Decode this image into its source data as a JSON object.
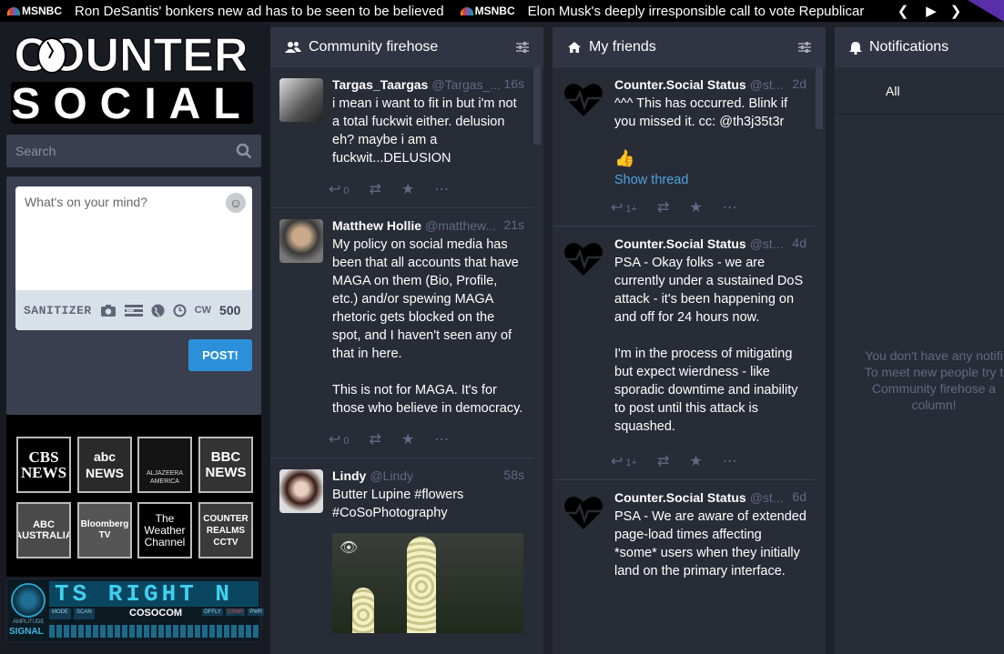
{
  "ticker": {
    "items": [
      {
        "source": "MSNBC",
        "headline": "Ron DeSantis' bonkers new ad has to be seen to be believed"
      },
      {
        "source": "MSNBC",
        "headline": "Elon Musk's deeply irresponsible call to vote Republicar"
      }
    ],
    "prev_icon": "chevron-left-icon",
    "play_icon": "play-icon",
    "next_icon": "chevron-right-icon"
  },
  "logo": {
    "line1": "COUNTER",
    "line2": "SOCIAL"
  },
  "search": {
    "placeholder": "Search"
  },
  "compose": {
    "placeholder": "What's on your mind?",
    "sanitizer_label": "SANITIZER",
    "cw_label": "CW",
    "char_count": "500",
    "post_label": "POST!"
  },
  "news_channels": [
    {
      "name": "CBS NEWS"
    },
    {
      "name": "abc NEWS"
    },
    {
      "name": "ALJAZEERA AMERICA"
    },
    {
      "name": "BBC NEWS"
    },
    {
      "name": "ABC AUSTRALIA"
    },
    {
      "name": "Bloomberg TV"
    },
    {
      "name": "The Weather Channel"
    },
    {
      "name": "COUNTER REALMS CCTV"
    }
  ],
  "radio": {
    "display": "TS RIGHT N",
    "brand": "COSOCOM",
    "signal_label": "SIGNAL",
    "amplitude_label": "AMPLITUDE",
    "buttons": [
      "MODE",
      "SCAN",
      "OFFLY",
      "OSNR",
      "PWR"
    ]
  },
  "columns": {
    "firehose": {
      "title": "Community firehose",
      "statuses": [
        {
          "name": "Targas_Taargas",
          "acct": "@Targas_...",
          "time": "16s",
          "body": [
            "i mean i want to fit in but i'm not a total fuckwit either. delusion eh? maybe i am a fuckwit...DELUSION"
          ],
          "replies": "0"
        },
        {
          "name": "Matthew Hollie",
          "acct": "@matthew...",
          "time": "21s",
          "body": [
            "My policy on social media has been that all accounts that have MAGA on them (Bio, Profile, etc.) and/or spewing MAGA rhetoric gets blocked on the spot, and I haven't seen any of that in here.",
            "This is not for MAGA. It's for those who believe in democracy."
          ],
          "replies": "0"
        },
        {
          "name": "Lindy",
          "acct": "@Lindy",
          "time": "58s",
          "body": [
            "Butter Lupine #flowers #CoSoPhotography"
          ]
        }
      ]
    },
    "friends": {
      "title": "My friends",
      "statuses": [
        {
          "name": "Counter.Social Status",
          "acct": "@st...",
          "time": "2d",
          "body": [
            "^^^ This has occurred. Blink if you missed it. cc: @th3j35t3r",
            "👍"
          ],
          "link": "Show thread",
          "replies": "1+"
        },
        {
          "name": "Counter.Social Status",
          "acct": "@st...",
          "time": "4d",
          "body": [
            "PSA - Okay folks - we are currently under a sustained DoS attack - it's been happening on and off for 24 hours now.",
            "I'm in the process of mitigating but expect wierdness - like sporadic downtime and inability to post until this attack is squashed."
          ],
          "replies": "1+"
        },
        {
          "name": "Counter.Social Status",
          "acct": "@st...",
          "time": "6d",
          "body": [
            "PSA - We are aware of extended page-load times affecting *some* users when they initially land on the primary interface."
          ]
        }
      ]
    },
    "notifications": {
      "title": "Notifications",
      "tab_all": "All",
      "empty_lines": [
        "You don't have any notifi",
        "To meet new people try t",
        "Community firehose a",
        "column!"
      ]
    }
  },
  "colors": {
    "accent": "#2b90d9",
    "column_bg": "#282c37",
    "header_bg": "#313543",
    "muted": "#606984"
  }
}
